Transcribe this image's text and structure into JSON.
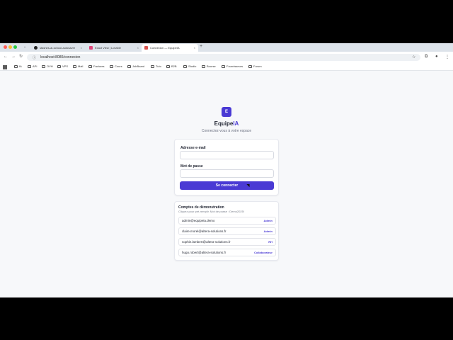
{
  "browser": {
    "tabs": [
      {
        "label": "stashes-ai-school-autosaver",
        "favicon_color": "#222222"
      },
      {
        "label": "Exact View | Lovable",
        "favicon_color": "#e0457b"
      },
      {
        "label": "Connexion — EquipeIA",
        "favicon_color": "#d9534f"
      }
    ],
    "new_tab": "+",
    "url": "localhost:8080/connexion",
    "bookmarks": [
      "IA",
      "API",
      "OVH",
      "VPS",
      "Mail",
      "Factures",
      "Cours",
      "JobBoard",
      "Tuto",
      "B2B",
      "Studio",
      "Bourse",
      "Fournisseurs",
      "Forum"
    ]
  },
  "page": {
    "logo_letter": "E",
    "brand_main": "Equipe",
    "brand_accent": "IA",
    "subtitle": "Connectez-vous à votre espace",
    "accent_color": "#4a3ad4"
  },
  "login": {
    "email_label": "Adresse e-mail",
    "email_value": "",
    "password_label": "Mot de passe",
    "password_value": "",
    "submit_label": "Se connecter"
  },
  "demo": {
    "title": "Comptes de démonstration",
    "hint": "Cliquez pour pré-remplir. Mot de passe : Demo2025!",
    "accounts": [
      {
        "email": "admin@equipeia.demo",
        "role": "Admin"
      },
      {
        "email": "claire.morel@altera-solutions.fr",
        "role": "Admin"
      },
      {
        "email": "sophie.lambert@altera-solutions.fr",
        "role": "RH"
      },
      {
        "email": "hugo.robert@altera-solutions.fr",
        "role": "Collaborateur"
      }
    ]
  }
}
